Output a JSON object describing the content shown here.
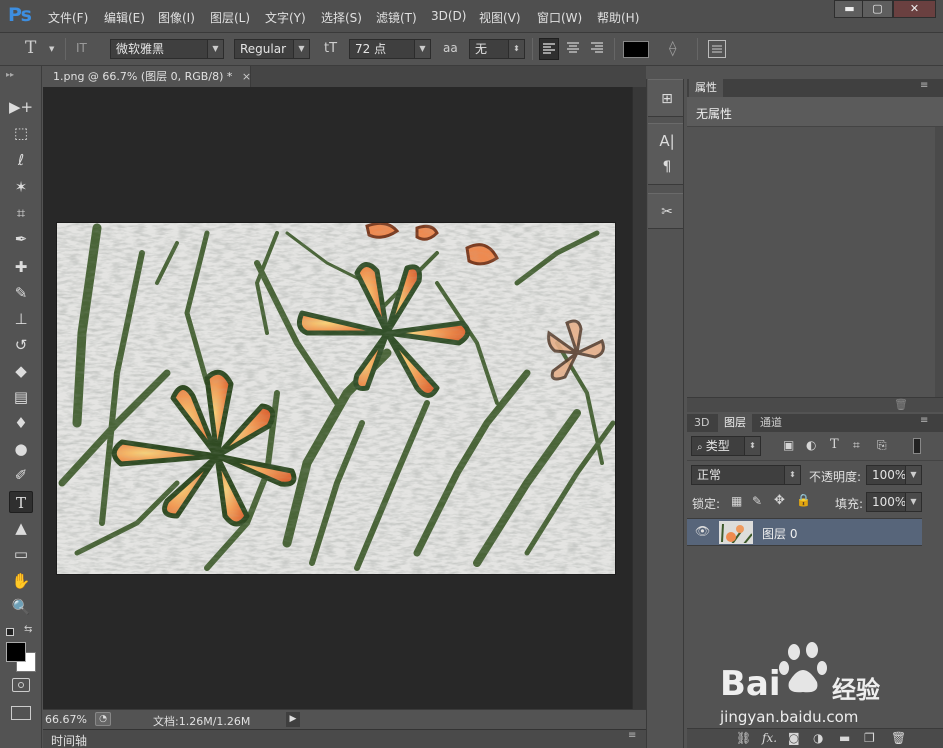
{
  "app": {
    "logo": "Ps"
  },
  "menu": [
    "文件(F)",
    "编辑(E)",
    "图像(I)",
    "图层(L)",
    "文字(Y)",
    "选择(S)",
    "滤镜(T)",
    "3D(D)",
    "视图(V)",
    "窗口(W)",
    "帮助(H)"
  ],
  "window_controls": {
    "minimize": "▬",
    "restore": "▢",
    "close": "✕"
  },
  "options": {
    "tool_glyph": "T",
    "orient_glyph": "IT",
    "font_family": "微软雅黑",
    "font_style": "Regular",
    "size_glyph": "tT",
    "font_size": "72 点",
    "aa_glyph": "aa",
    "antialias": "无",
    "text_color": "#000000"
  },
  "tools": [
    {
      "name": "move-tool",
      "glyph": "▶+"
    },
    {
      "name": "marquee-tool",
      "glyph": "⬚"
    },
    {
      "name": "lasso-tool",
      "glyph": "ℓ"
    },
    {
      "name": "magic-wand-tool",
      "glyph": "✶"
    },
    {
      "name": "crop-tool",
      "glyph": "⌗"
    },
    {
      "name": "eyedropper-tool",
      "glyph": "✒"
    },
    {
      "name": "healing-brush-tool",
      "glyph": "✚"
    },
    {
      "name": "brush-tool",
      "glyph": "✎"
    },
    {
      "name": "stamp-tool",
      "glyph": "⊥"
    },
    {
      "name": "history-brush-tool",
      "glyph": "↺"
    },
    {
      "name": "eraser-tool",
      "glyph": "◆"
    },
    {
      "name": "gradient-tool",
      "glyph": "▤"
    },
    {
      "name": "blur-tool",
      "glyph": "♦"
    },
    {
      "name": "dodge-tool",
      "glyph": "●"
    },
    {
      "name": "pen-tool",
      "glyph": "✐"
    },
    {
      "name": "type-tool",
      "glyph": "T"
    },
    {
      "name": "path-selection-tool",
      "glyph": "▲"
    },
    {
      "name": "shape-tool",
      "glyph": "▭"
    },
    {
      "name": "hand-tool",
      "glyph": "✋"
    },
    {
      "name": "zoom-tool",
      "glyph": "🔍"
    }
  ],
  "document": {
    "tab_title": "1.png @ 66.7% (图层 0, RGB/8) *",
    "tab_close": "×",
    "zoom": "66.67%",
    "doc_info": "文档:1.26M/1.26M"
  },
  "timeline": {
    "label": "时间轴"
  },
  "properties": {
    "tab": "属性",
    "content": "无属性"
  },
  "layers": {
    "tabs": [
      "3D",
      "图层",
      "通道"
    ],
    "filter_label": "类型",
    "blend_mode": "正常",
    "opacity_label": "不透明度:",
    "opacity": "100%",
    "lock_label": "锁定:",
    "fill_label": "填充:",
    "fill": "100%",
    "items": [
      {
        "name": "图层 0"
      }
    ]
  },
  "watermark": {
    "brand": "Bai",
    "brand2": "经验",
    "url": "jingyan.baidu.com"
  }
}
